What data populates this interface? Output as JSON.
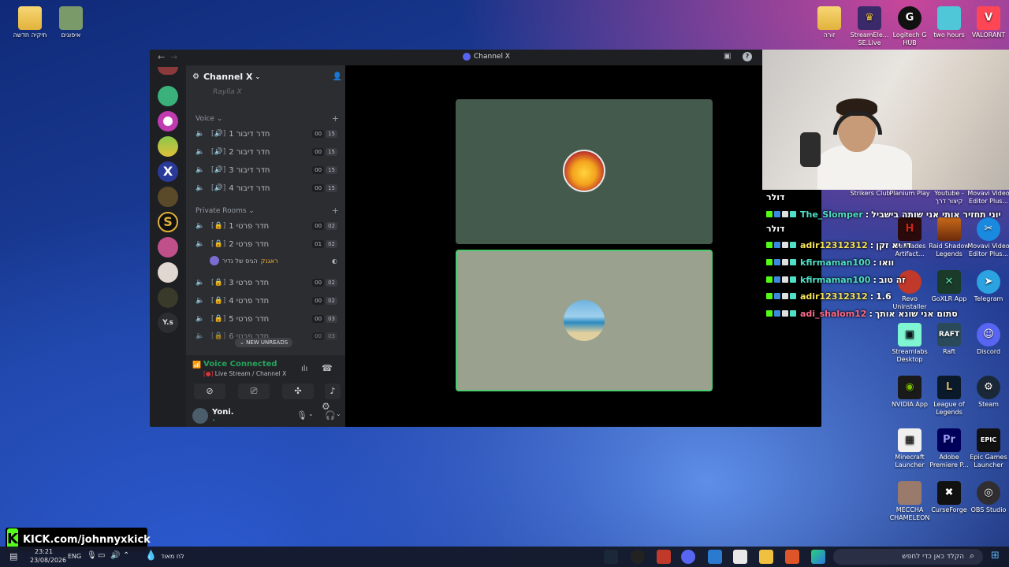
{
  "desktop": {
    "left_icons": [
      {
        "label": "תיקיה חדשה"
      },
      {
        "label": "איפוגים"
      }
    ],
    "top_right_icons": [
      {
        "label": "זורה"
      },
      {
        "label": "StreamEle... SE.Live"
      },
      {
        "label": "Logitech G HUB"
      },
      {
        "label": "two hours"
      },
      {
        "label": "VALORANT"
      }
    ],
    "right_icons": [
      {
        "label": "Strikers Club"
      },
      {
        "label": "Planium Play"
      },
      {
        "label": "Youtube - קיצור דרך"
      },
      {
        "label": "Movavi Video Editor Plus..."
      },
      {
        "label": "HellHades Artifact..."
      },
      {
        "label": "Raid Shadow Legends"
      },
      {
        "label": "Movavi Video Editor Plus..."
      },
      {
        "label": "Revo Uninstaller"
      },
      {
        "label": "GoXLR App"
      },
      {
        "label": "Telegram"
      },
      {
        "label": "Streamlabs Desktop"
      },
      {
        "label": "Raft"
      },
      {
        "label": "Discord"
      },
      {
        "label": "NVIDIA App"
      },
      {
        "label": "League of Legends"
      },
      {
        "label": "Steam"
      },
      {
        "label": "Minecraft Launcher"
      },
      {
        "label": "Adobe Premiere P..."
      },
      {
        "label": "Epic Games Launcher"
      },
      {
        "label": "MECCHA CHAMELEON"
      },
      {
        "label": "CurseForge"
      },
      {
        "label": "OBS Studio"
      }
    ]
  },
  "discord": {
    "window_title": "Channel X",
    "server_name": "Channel X",
    "hidden_row": "Raylla X",
    "voice_category": "Voice",
    "private_category": "Private Rooms",
    "voice_channels": [
      {
        "name": "חדר דיבור 1",
        "count": "00",
        "limit": "15"
      },
      {
        "name": "חדר דיבור 2",
        "count": "00",
        "limit": "15"
      },
      {
        "name": "חדר דיבור 3",
        "count": "00",
        "limit": "15"
      },
      {
        "name": "חדר דיבור 4",
        "count": "00",
        "limit": "15"
      }
    ],
    "private_rooms": [
      {
        "name": "חדר פרטי 1",
        "count": "00",
        "limit": "02"
      },
      {
        "name": "חדר פרטי 2",
        "count": "01",
        "limit": "02"
      },
      {
        "name": "חדר פרטי 3",
        "count": "00",
        "limit": "02"
      },
      {
        "name": "חדר פרטי 4",
        "count": "00",
        "limit": "02"
      },
      {
        "name": "חדר פרטי 5",
        "count": "00",
        "limit": "03"
      },
      {
        "name": "חדר פרטי 6",
        "count": "00",
        "limit": "03"
      }
    ],
    "member_in_room": "הגיס של נדיר",
    "member_tag": "ראגנק",
    "new_unreads": "NEW UNREADS",
    "voice_connected": "Voice Connected",
    "voice_location": "Live Stream / Channel X",
    "user_name": "Yoni.",
    "user_status": "•",
    "server_label_ys": "Y.s"
  },
  "chat": [
    {
      "user": "",
      "message": "דולר",
      "user_color": "#ffffff"
    },
    {
      "user": "The_Slomper",
      "message": "יוני תחזיר אותי אני שותה בישביל",
      "user_color": "#4fe0c8"
    },
    {
      "user": "",
      "message": "דולר",
      "user_color": "#ffffff"
    },
    {
      "user": "adir12312312",
      "message": "די יא זקן",
      "user_color": "#f7e45a"
    },
    {
      "user": "kfirmaman100",
      "message": "וואו",
      "user_color": "#4fe0c8"
    },
    {
      "user": "kfirmaman100",
      "message": "זה טוב",
      "user_color": "#4fe0c8"
    },
    {
      "user": "adir12312312",
      "message": "1.6",
      "user_color": "#f7e45a"
    },
    {
      "user": "adi_shalom12",
      "message": "סתום אני שונא אותך",
      "user_color": "#ff6b8a"
    }
  ],
  "kick": {
    "url": "KICK.com/johnnyxkick"
  },
  "taskbar": {
    "time": "23:21",
    "date": "23/08/2026",
    "language": "ENG",
    "weather": "לח מאוד",
    "search_placeholder": "הקלד כאן כדי לחפש"
  }
}
